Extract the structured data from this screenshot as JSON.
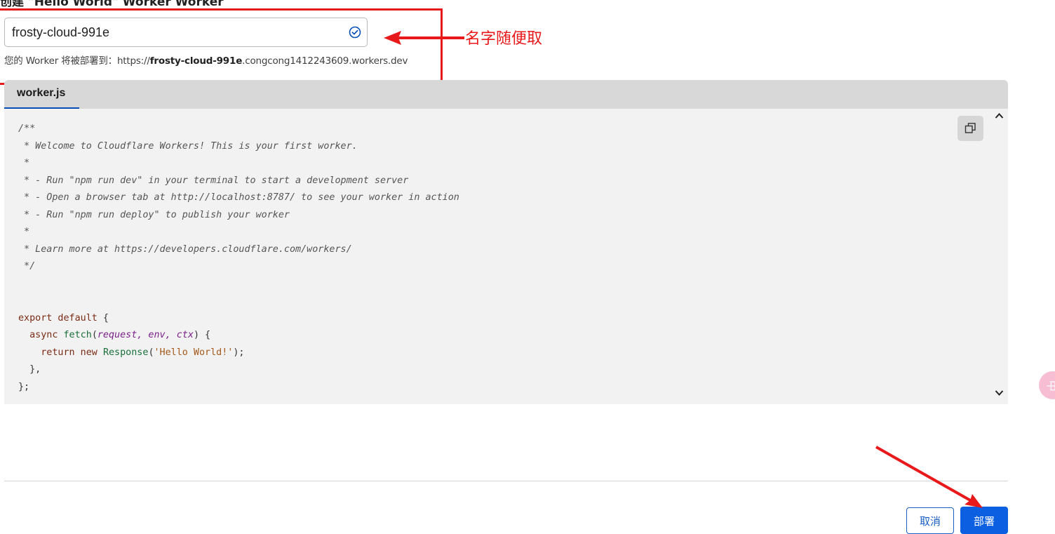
{
  "page": {
    "title": "创建 \"Hello World\" Worker Worker"
  },
  "form": {
    "worker_name_value": "frosty-cloud-991e",
    "deploy_hint_prefix": "您的 Worker 将被部署到：https://",
    "deploy_hint_name": "frosty-cloud-991e",
    "deploy_hint_suffix": ".congcong1412243609.workers.dev"
  },
  "annotation": {
    "note": "名字随便取",
    "color": "#e8191b"
  },
  "editor": {
    "active_tab": "worker.js",
    "copy_icon": "copy-icon",
    "lines": {
      "l1": "/**",
      "l2": " * Welcome to Cloudflare Workers! This is your first worker.",
      "l3": " *",
      "l4": " * - Run \"npm run dev\" in your terminal to start a development server",
      "l5": " * - Open a browser tab at http://localhost:8787/ to see your worker in action",
      "l6": " * - Run \"npm run deploy\" to publish your worker",
      "l7": " *",
      "l8": " * Learn more at https://developers.cloudflare.com/workers/",
      "l9": " */",
      "l12_kw": "export default",
      "l12_rest": " {",
      "l13_kw": "  async ",
      "l13_fn": "fetch",
      "l13_open": "(",
      "l13_params": "request, env, ctx",
      "l13_close": ") {",
      "l14_kw": "    return new ",
      "l14_fn": "Response",
      "l14_open": "(",
      "l14_str": "'Hello World!'",
      "l14_close": ");",
      "l15": "  },",
      "l16": "};"
    }
  },
  "actions": {
    "cancel_label": "取消",
    "deploy_label": "部署",
    "primary_color": "#0b5fe0"
  },
  "floating": {
    "badge_text": "中"
  }
}
